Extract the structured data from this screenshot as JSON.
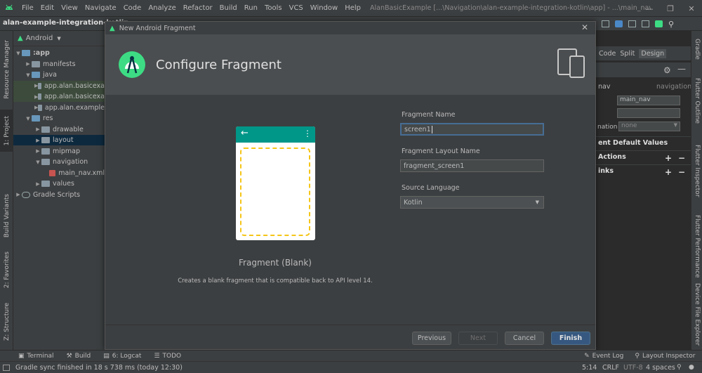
{
  "menu": {
    "items": [
      "File",
      "Edit",
      "View",
      "Navigate",
      "Code",
      "Analyze",
      "Refactor",
      "Build",
      "Run",
      "Tools",
      "VCS",
      "Window",
      "Help"
    ],
    "window_title": "AlanBasicExample [...\\Navigation\\alan-example-integration-kotlin\\app] - ...\\main_nav.xml [app]"
  },
  "nav": {
    "project": "alan-example-integration-kotlin"
  },
  "left_strip": {
    "resource_manager": "Resource Manager",
    "project": "1: Project",
    "build_variants": "Build Variants",
    "favorites": "2: Favorites",
    "structure": "Z: Structure"
  },
  "project_panel": {
    "view": "Android",
    "tree": [
      {
        "label": ":app",
        "depth": 0,
        "expanded": true,
        "bold": true
      },
      {
        "label": "manifests",
        "depth": 1,
        "expanded": false
      },
      {
        "label": "java",
        "depth": 1,
        "expanded": true
      },
      {
        "label": "app.alan.basicexa",
        "depth": 2,
        "expanded": false,
        "hl": true
      },
      {
        "label": "app.alan.basicexa",
        "depth": 2,
        "expanded": false,
        "hl": true
      },
      {
        "label": "app.alan.example",
        "depth": 2,
        "expanded": false
      },
      {
        "label": "res",
        "depth": 1,
        "expanded": true
      },
      {
        "label": "drawable",
        "depth": 2,
        "expanded": false
      },
      {
        "label": "layout",
        "depth": 2,
        "expanded": false,
        "sel": true
      },
      {
        "label": "mipmap",
        "depth": 2,
        "expanded": false
      },
      {
        "label": "navigation",
        "depth": 2,
        "expanded": true
      },
      {
        "label": "main_nav.xml",
        "depth": 3,
        "file": true
      },
      {
        "label": "values",
        "depth": 2,
        "expanded": false
      },
      {
        "label": "Gradle Scripts",
        "depth": 0,
        "expanded": false,
        "gradle": true
      }
    ]
  },
  "editor_right": {
    "view_modes": [
      "Code",
      "Split",
      "Design"
    ],
    "id_value": "main_nav",
    "nav_label": "nav",
    "navigation_label": "navigation",
    "start_dest_label": "nation",
    "start_dest_value": "none",
    "sections": [
      "ent Default Values",
      "Actions",
      "inks"
    ]
  },
  "right_strip": {
    "gradle": "Gradle",
    "flutter_outline": "Flutter Outline",
    "flutter_inspector": "Flutter Inspector",
    "flutter_performance": "Flutter Performance",
    "device_file_explorer": "Device File Explorer"
  },
  "dialog": {
    "title": "New Android Fragment",
    "header": "Configure Fragment",
    "template_name": "Fragment (Blank)",
    "template_desc": "Creates a blank fragment that is compatible back to API level 14.",
    "fragment_name_label": "Fragment Name",
    "fragment_name_value": "screen1",
    "layout_name_label": "Fragment Layout Name",
    "layout_name_value": "fragment_screen1",
    "language_label": "Source Language",
    "language_value": "Kotlin",
    "buttons": {
      "previous": "Previous",
      "next": "Next",
      "cancel": "Cancel",
      "finish": "Finish"
    }
  },
  "tool_windows": {
    "terminal": "Terminal",
    "build": "Build",
    "logcat": "6: Logcat",
    "todo": "TODO",
    "event_log": "Event Log",
    "layout_inspector": "Layout Inspector"
  },
  "status": {
    "message": "Gradle sync finished in 18 s 738 ms (today 12:30)",
    "position": "5:14",
    "line_sep": "CRLF",
    "encoding": "UTF-8",
    "indent": "4 spaces"
  },
  "colors": {
    "accent": "#4a88c7",
    "android_green": "#3ddc84",
    "teal": "#009688",
    "dashed": "#f5c518"
  }
}
